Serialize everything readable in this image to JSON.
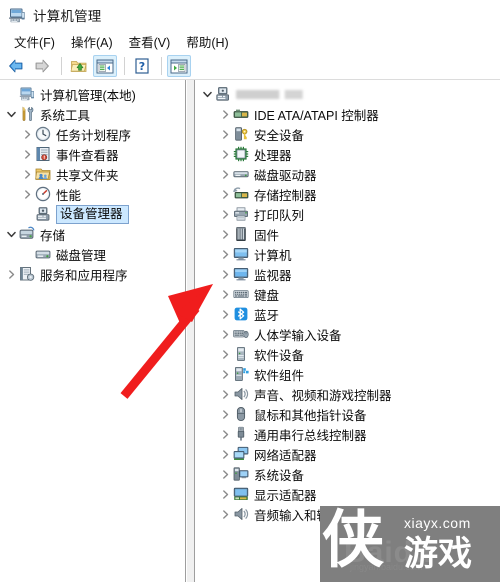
{
  "window": {
    "title": "计算机管理",
    "title_icon": "computer-management-icon"
  },
  "menubar": {
    "items": [
      {
        "label": "文件(F)",
        "name": "menu-file"
      },
      {
        "label": "操作(A)",
        "name": "menu-action"
      },
      {
        "label": "查看(V)",
        "name": "menu-view"
      },
      {
        "label": "帮助(H)",
        "name": "menu-help"
      }
    ]
  },
  "toolbar": {
    "buttons": [
      {
        "name": "back-button",
        "icon": "arrow-left-icon",
        "pressed": false
      },
      {
        "name": "forward-button",
        "icon": "arrow-right-icon",
        "pressed": false
      },
      {
        "name": "up-folder-button",
        "icon": "folder-up-icon",
        "pressed": false
      },
      {
        "name": "show-console-tree-button",
        "icon": "console-tree-icon",
        "pressed": true
      },
      {
        "name": "help-button",
        "icon": "question-mark-icon",
        "pressed": false
      },
      {
        "name": "show-action-pane-button",
        "icon": "action-pane-icon",
        "pressed": true
      }
    ]
  },
  "tree_left": {
    "items": [
      {
        "label": "计算机管理(本地)",
        "indent": 0,
        "expander": "none",
        "icon": "computer-icon",
        "selected": false
      },
      {
        "label": "系统工具",
        "indent": 0,
        "expander": "expanded",
        "icon": "system-tools-icon",
        "selected": false
      },
      {
        "label": "任务计划程序",
        "indent": 1,
        "expander": "collapsed",
        "icon": "task-scheduler-icon",
        "selected": false
      },
      {
        "label": "事件查看器",
        "indent": 1,
        "expander": "collapsed",
        "icon": "event-viewer-icon",
        "selected": false
      },
      {
        "label": "共享文件夹",
        "indent": 1,
        "expander": "collapsed",
        "icon": "shared-folders-icon",
        "selected": false
      },
      {
        "label": "性能",
        "indent": 1,
        "expander": "collapsed",
        "icon": "performance-icon",
        "selected": false
      },
      {
        "label": "设备管理器",
        "indent": 1,
        "expander": "none",
        "icon": "device-manager-icon",
        "selected": true
      },
      {
        "label": "存储",
        "indent": 0,
        "expander": "expanded",
        "icon": "storage-icon",
        "selected": false
      },
      {
        "label": "磁盘管理",
        "indent": 1,
        "expander": "none",
        "icon": "disk-management-icon",
        "selected": false
      },
      {
        "label": "服务和应用程序",
        "indent": 0,
        "expander": "collapsed",
        "icon": "services-apps-icon",
        "selected": false
      }
    ]
  },
  "tree_right": {
    "root": {
      "label": "",
      "redacted": true,
      "expander": "expanded",
      "icon": "computer-icon"
    },
    "items": [
      {
        "label": "IDE ATA/ATAPI 控制器",
        "icon": "ide-controller-icon"
      },
      {
        "label": "安全设备",
        "icon": "security-device-icon"
      },
      {
        "label": "处理器",
        "icon": "processor-icon"
      },
      {
        "label": "磁盘驱动器",
        "icon": "disk-drive-icon"
      },
      {
        "label": "存储控制器",
        "icon": "storage-controller-icon"
      },
      {
        "label": "打印队列",
        "icon": "printer-icon"
      },
      {
        "label": "固件",
        "icon": "firmware-icon"
      },
      {
        "label": "计算机",
        "icon": "computer-icon"
      },
      {
        "label": "监视器",
        "icon": "monitor-icon"
      },
      {
        "label": "键盘",
        "icon": "keyboard-icon"
      },
      {
        "label": "蓝牙",
        "icon": "bluetooth-icon"
      },
      {
        "label": "人体学输入设备",
        "icon": "hid-icon"
      },
      {
        "label": "软件设备",
        "icon": "software-device-icon"
      },
      {
        "label": "软件组件",
        "icon": "software-component-icon"
      },
      {
        "label": "声音、视频和游戏控制器",
        "icon": "sound-video-game-icon"
      },
      {
        "label": "鼠标和其他指针设备",
        "icon": "mouse-icon"
      },
      {
        "label": "通用串行总线控制器",
        "icon": "usb-controller-icon"
      },
      {
        "label": "网络适配器",
        "icon": "network-adapter-icon"
      },
      {
        "label": "系统设备",
        "icon": "system-device-icon"
      },
      {
        "label": "显示适配器",
        "icon": "display-adapter-icon"
      },
      {
        "label": "音频输入和输出",
        "icon": "audio-io-icon"
      }
    ]
  },
  "annotation": {
    "arrow": {
      "name": "red-arrow-annotation",
      "color": "#f01d1d",
      "points_to": "监视器"
    }
  },
  "watermark": {
    "hanzi": "侠",
    "site": "xiayx.com",
    "word": "游戏",
    "ghost_text": "Baidu",
    "ghost_sub": "jingyan.baidu.com",
    "background": "#7f7f7f"
  },
  "colors": {
    "selection": "#cce8ff",
    "selection_border": "#7da2ce",
    "toolbar_pressed": "#dcf0fb",
    "pane_border": "#9e9e9e",
    "annotation_red": "#f01d1d"
  }
}
